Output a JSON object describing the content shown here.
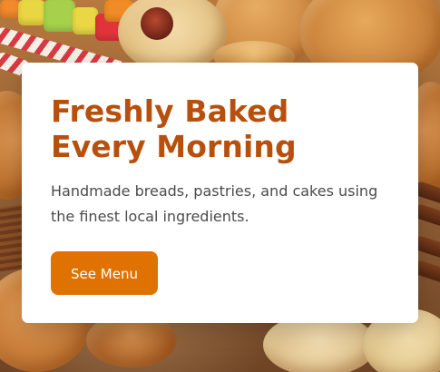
{
  "hero": {
    "title": "Freshly Baked Every Morning",
    "description": "Handmade breads, pastries, and cakes using the finest local ingredients.",
    "button_label": "See Menu"
  },
  "colors": {
    "accent": "#df7200",
    "title": "#b8500d",
    "card_background": "#ffffff",
    "body_text": "#4b4b4b"
  }
}
